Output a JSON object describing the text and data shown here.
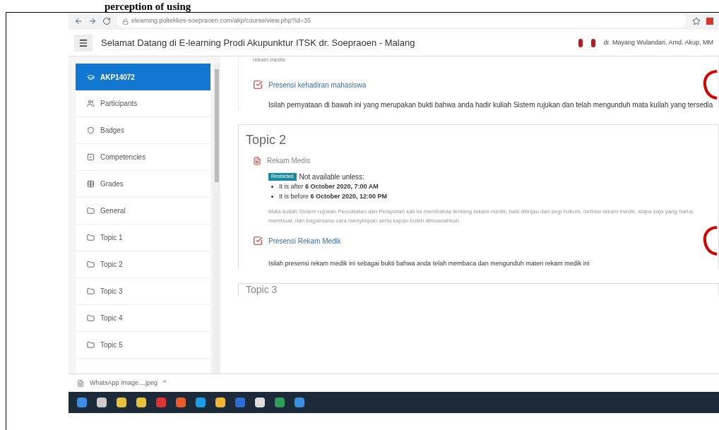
{
  "document_heading": "perception of using",
  "browser": {
    "url": "elearning.poltekkes-soepraoen.com/akp/course/view.php?id=35"
  },
  "header": {
    "title": "Selamat Datang di E-learning Prodi Akupunktur ITSK dr. Soepraoen - Malang",
    "user": "dr. Mayang Wulandari, Amd. Akup, MM"
  },
  "sidebar": {
    "items": [
      {
        "label": "AKP14072",
        "selected": true
      },
      {
        "label": "Participants",
        "selected": false
      },
      {
        "label": "Badges",
        "selected": false
      },
      {
        "label": "Competencies",
        "selected": false
      },
      {
        "label": "Grades",
        "selected": false
      },
      {
        "label": "General",
        "selected": false
      },
      {
        "label": "Topic 1",
        "selected": false
      },
      {
        "label": "Topic 2",
        "selected": false
      },
      {
        "label": "Topic 3",
        "selected": false
      },
      {
        "label": "Topic 4",
        "selected": false
      },
      {
        "label": "Topic 5",
        "selected": false
      }
    ]
  },
  "content": {
    "top_text": "rekam medis",
    "topic1_activity": {
      "title": "Presensi kehadiran mahasiswa",
      "description": "Isilah pernyataan di bawah ini yang merupakan bukti bahwa anda hadir kuliah Sistem rujukan dan telah mengunduh mata kuliah yang tersedia"
    },
    "topic2": {
      "title": "Topic 2",
      "resource": "Rekam Medis",
      "badge": "Restricted",
      "restriction": "Not available unless:",
      "conditions": [
        "It is after **6 October 2020, 7:00 AM**",
        "It is before **6 October 2020, 12:00 PM**"
      ],
      "summary": "Mata kuliah Sistem rujukan Pencatatan dan Pelaporan kali ini membahas tentang rekam medik, baik ditinjau dari segi hukum, definisi rekam medik, siapa saja yang harus membuat, dan bagaimana cara menyimpan serta kapan boleh dimusnahkan",
      "attendance": "Presensi Rekam Medik",
      "attendance_note": "Isilah presensi rekam medik ini sebagai bukti bahwa anda telah membaca dan mengunduh materi rekam medik ini"
    },
    "next_topic": "Topic 3"
  },
  "download": {
    "file": "WhatsApp Image....jpeg",
    "caret": "^"
  }
}
